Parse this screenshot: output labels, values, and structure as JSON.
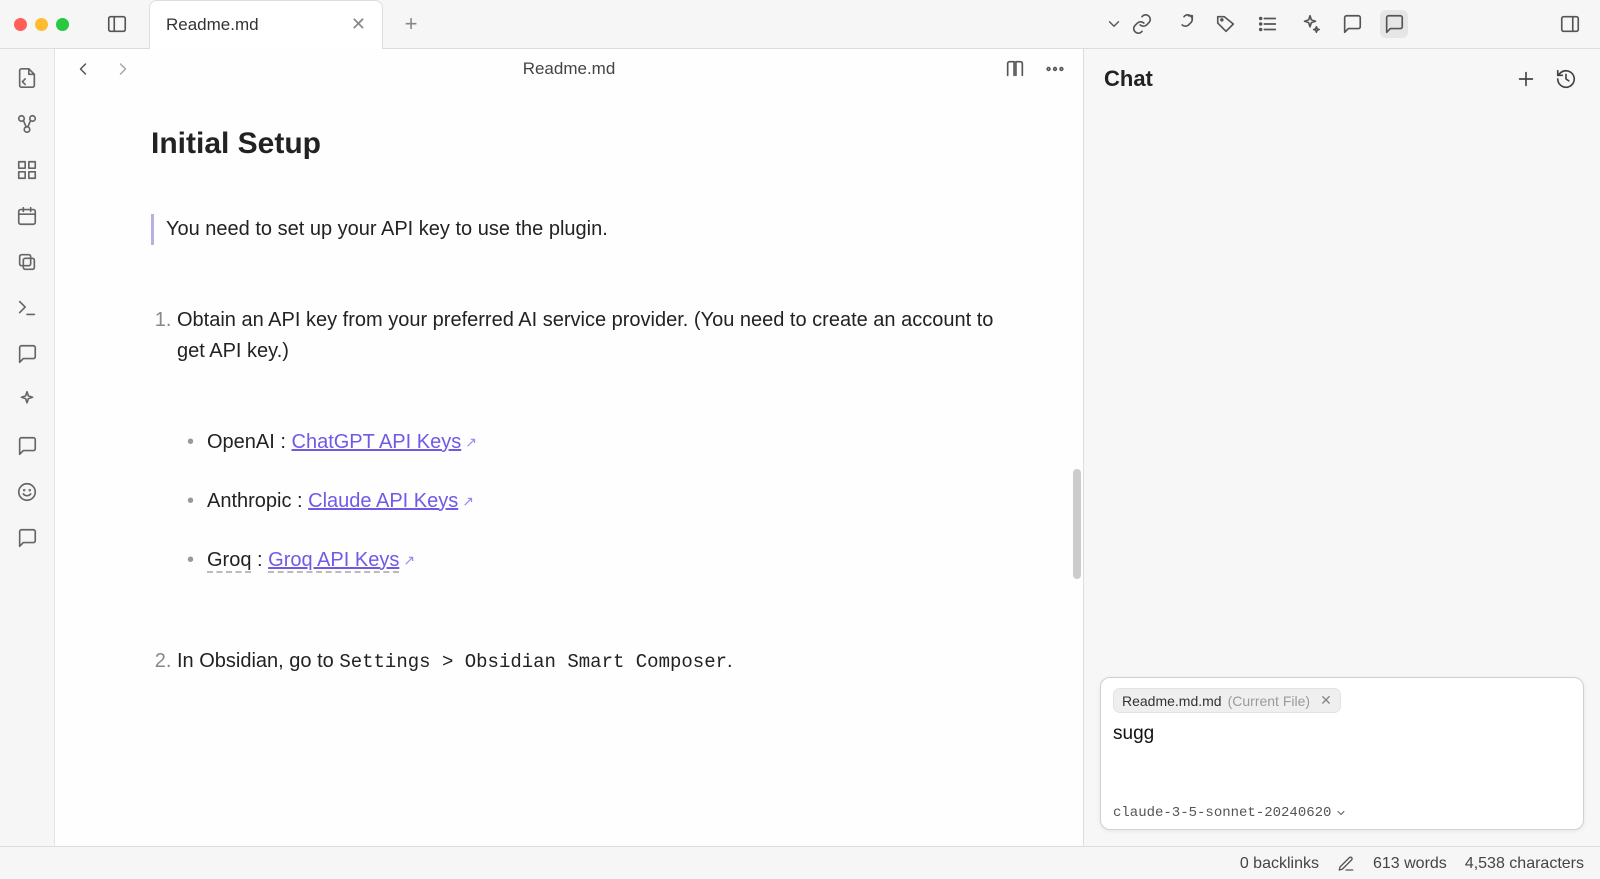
{
  "tab": {
    "title": "Readme.md"
  },
  "header": {
    "doc_title": "Readme.md"
  },
  "doc": {
    "h2": "Initial Setup",
    "blockquote": "You need to set up your API key to use the plugin.",
    "ol1": "Obtain an API key from your preferred AI service provider. (You need to create an account to get API key.)",
    "openai_label": "OpenAI",
    "openai_sep": " : ",
    "openai_link": "ChatGPT API Keys",
    "anthropic_label": "Anthropic",
    "anthropic_sep": " : ",
    "anthropic_link": "Claude API Keys",
    "groq_label": "Groq",
    "groq_sep": " : ",
    "groq_link": "Groq API Keys",
    "ol2_prefix": "In Obsidian, go to ",
    "ol2_code": "Settings > Obsidian Smart Composer",
    "ol2_suffix": "."
  },
  "chat": {
    "title": "Chat",
    "chip_name": "Readme.md.md",
    "chip_suffix": "(Current File)",
    "input_value": "sugg",
    "model": "claude-3-5-sonnet-20240620"
  },
  "status": {
    "backlinks": "0 backlinks",
    "words": "613 words",
    "chars": "4,538 characters"
  }
}
